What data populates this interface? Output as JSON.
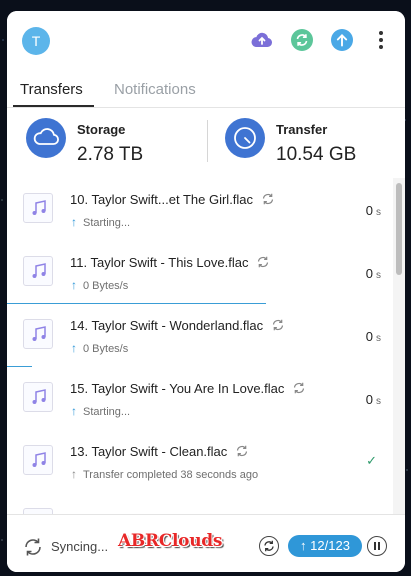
{
  "header": {
    "avatar_letter": "T",
    "icons": [
      "cloud-upload-icon",
      "sync-icon",
      "upload-icon",
      "more-vertical-icon"
    ]
  },
  "tabs": [
    {
      "label": "Transfers",
      "active": true
    },
    {
      "label": "Notifications",
      "active": false
    }
  ],
  "stats": {
    "storage": {
      "label": "Storage",
      "value": "2.78 TB",
      "icon": "cloud-icon"
    },
    "transfer": {
      "label": "Transfer",
      "value": "10.54 GB",
      "icon": "clock-icon"
    }
  },
  "transfers": [
    {
      "name": "10. Taylor Swift...et The Girl.flac",
      "status": "Starting...",
      "time": "0",
      "unit": "s",
      "progress": 0
    },
    {
      "name": "11. Taylor Swift - This Love.flac",
      "status": "0 Bytes/s",
      "time": "0",
      "unit": "s",
      "progress": 0.67
    },
    {
      "name": "14. Taylor Swift - Wonderland.flac",
      "status": "0 Bytes/s",
      "time": "0",
      "unit": "s",
      "progress": 0.065
    },
    {
      "name": "15. Taylor Swift - You Are In Love.flac",
      "status": "Starting...",
      "time": "0",
      "unit": "s",
      "progress": 0
    },
    {
      "name": "13. Taylor Swift - Clean.flac",
      "status": "Transfer completed 38 seconds ago",
      "completed": true
    }
  ],
  "footer": {
    "sync_label": "Syncing...",
    "watermark": "ABRClouds",
    "counter": "12/123"
  },
  "colors": {
    "accent": "#2f97d8",
    "stat_circle": "#3f74d2",
    "check": "#2e9a6b",
    "upload_purple": "#7b6fd8",
    "sync_green": "#5cc69a"
  }
}
